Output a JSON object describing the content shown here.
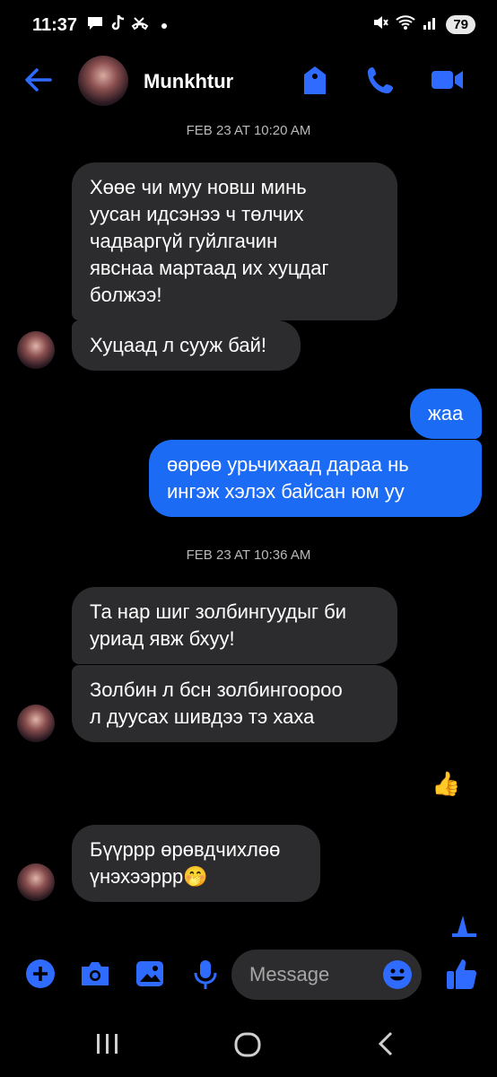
{
  "status": {
    "time": "11:37",
    "battery": "79"
  },
  "header": {
    "contact_name": "Munkhtur"
  },
  "colors": {
    "accent": "#1c6bf5",
    "incoming_bubble": "#2c2c2e",
    "background": "#000000"
  },
  "conversation": {
    "date1": "FEB 23 AT 10:20 AM",
    "msg1": [
      "Хөөе чи муу новш минь",
      "уусан идсэнээ ч төлчих",
      "чадваргүй гуйлгачин",
      "явснаа мартаад их хуцдаг",
      "болжээ!"
    ],
    "msg2": "Хуцаад л сууж бай!",
    "msg3": "жаа",
    "msg4": [
      "өөрөө урьчихаад дараа нь",
      "ингэж хэлэх байсан юм уу"
    ],
    "date2": "FEB 23 AT 10:36 AM",
    "msg5": [
      "Та нар шиг золбингуудыг би",
      "уриад явж бхуу!"
    ],
    "msg6": [
      "Золбин л бсн золбингоороо",
      "л дуусах шивдээ тэ хаха"
    ],
    "msg7_reaction": "👍",
    "msg8": [
      "Бүүррр өрөвдчихлөө",
      "үнэхээррр🤭"
    ]
  },
  "composer": {
    "placeholder": "Message"
  },
  "icons": [
    "back-arrow-icon",
    "tag-icon",
    "phone-icon",
    "video-icon",
    "plus-icon",
    "camera-icon",
    "image-icon",
    "mic-icon",
    "emoji-icon",
    "thumbs-up-icon",
    "recents-icon",
    "home-icon",
    "nav-back-icon"
  ]
}
